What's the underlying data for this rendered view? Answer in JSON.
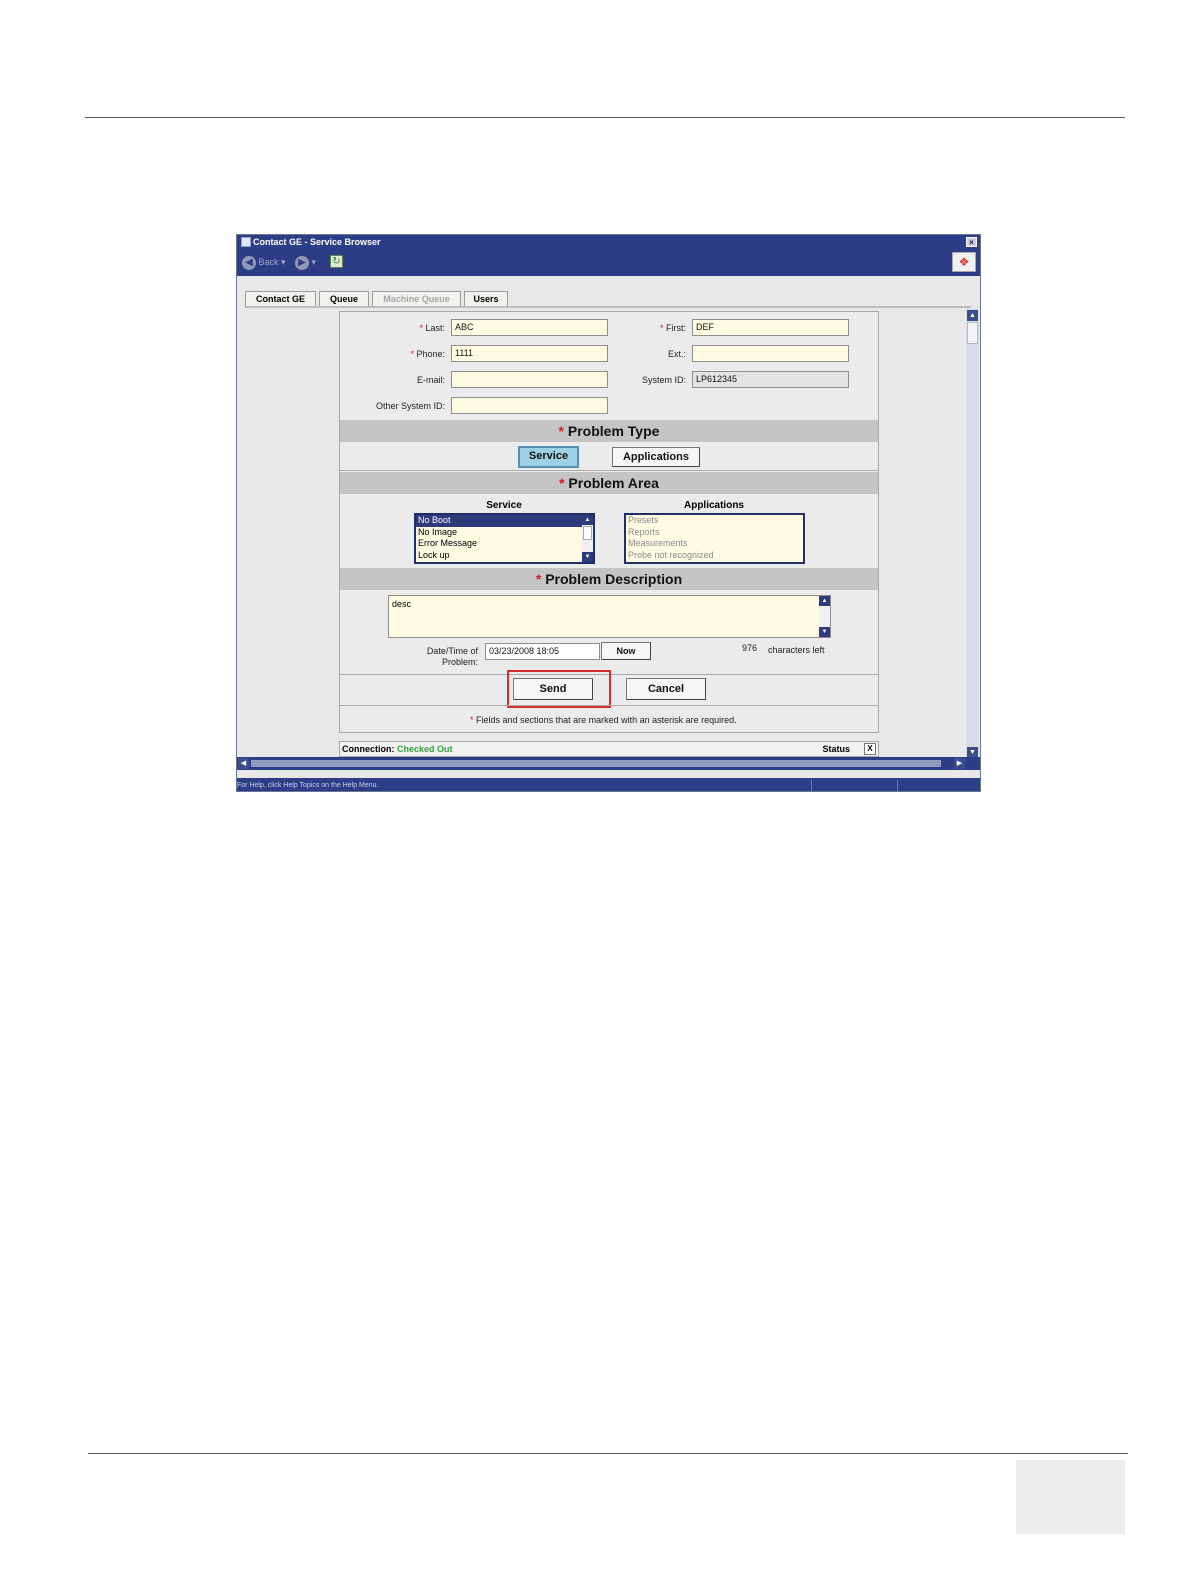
{
  "window": {
    "title": "Contact GE - Service Browser",
    "close_glyph": "×",
    "back_label": "Back",
    "status_text": "For Help, click Help Topics on the Help Menu."
  },
  "tabs": [
    {
      "label": "Contact GE",
      "enabled": true
    },
    {
      "label": "Queue",
      "enabled": true
    },
    {
      "label": "Machine Queue",
      "enabled": false
    },
    {
      "label": "Users",
      "enabled": true
    }
  ],
  "form": {
    "last_label": "Last:",
    "last_value": "ABC",
    "first_label": "First:",
    "first_value": "DEF",
    "phone_label": "Phone:",
    "phone_value": "1111",
    "ext_label": "Ext.:",
    "ext_value": "",
    "email_label": "E-mail:",
    "email_value": "",
    "system_id_label": "System ID:",
    "system_id_value": "LP612345",
    "other_system_id_label": "Other System ID:",
    "other_system_id_value": "",
    "required_mark": "*"
  },
  "problem_type": {
    "title": "Problem Type",
    "service_label": "Service",
    "applications_label": "Applications",
    "selected": "Service"
  },
  "problem_area": {
    "title": "Problem Area",
    "service_header": "Service",
    "applications_header": "Applications",
    "service_items": [
      "No Boot",
      "No Image",
      "Error Message",
      "Lock up"
    ],
    "service_selected": "No Boot",
    "applications_items": [
      "Presets",
      "Reports",
      "Measurements",
      "Probe not recognized"
    ]
  },
  "problem_description": {
    "title": "Problem Description",
    "text": "desc",
    "datetime_label_line1": "Date/Time of",
    "datetime_label_line2": "Problem:",
    "datetime_value": "03/23/2008 18:05",
    "now_label": "Now",
    "chars_left_count": "976",
    "chars_left_label": "characters left"
  },
  "actions": {
    "send_label": "Send",
    "cancel_label": "Cancel",
    "required_note": "Fields and sections that are marked with an asterisk are required."
  },
  "connection": {
    "label": "Connection:",
    "status_value": "Checked Out",
    "status_label": "Status",
    "close_glyph": "X"
  },
  "colors": {
    "titlebar": "#2d3e88",
    "required": "#d02020",
    "field_bg": "#fffbe3",
    "connected": "#35a043",
    "highlight": "#d23030"
  }
}
